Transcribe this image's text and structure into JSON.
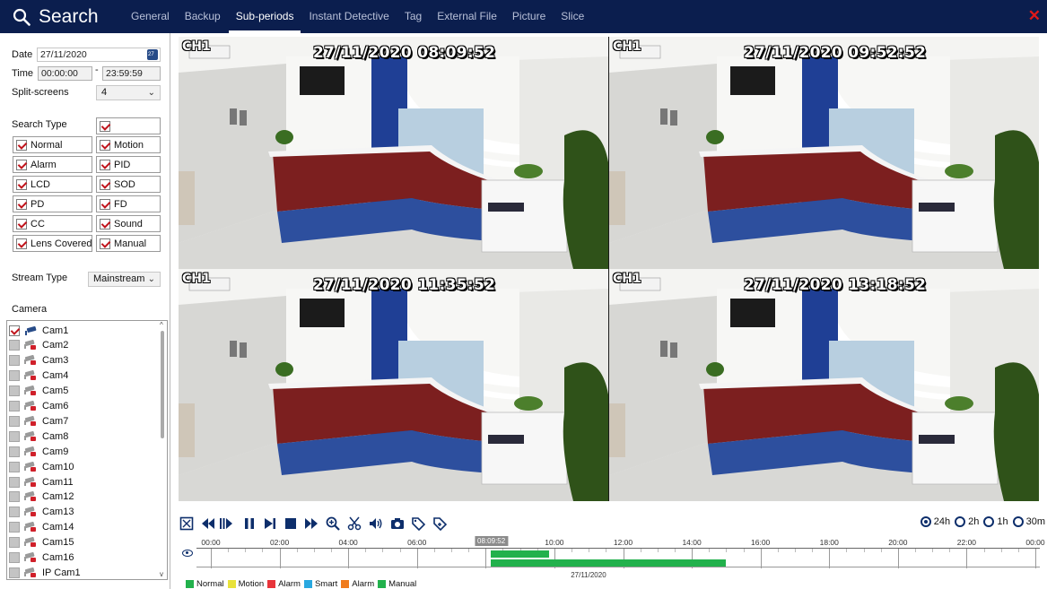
{
  "app": {
    "title": "Search"
  },
  "tabs": [
    "General",
    "Backup",
    "Sub-periods",
    "Instant Detective",
    "Tag",
    "External File",
    "Picture",
    "Slice"
  ],
  "active_tab": "Sub-periods",
  "left": {
    "date_label": "Date",
    "date_value": "27/11/2020",
    "time_label": "Time",
    "time_start": "00:00:00",
    "time_sep": "-",
    "time_end": "23:59:59",
    "split_label": "Split-screens",
    "split_value": "4",
    "search_type_label": "Search Type",
    "search_types": [
      "Normal",
      "Motion",
      "Alarm",
      "PID",
      "LCD",
      "SOD",
      "PD",
      "FD",
      "CC",
      "Sound",
      "Lens Covered",
      "Manual"
    ],
    "stream_label": "Stream Type",
    "stream_value": "Mainstream",
    "camera_label": "Camera",
    "cameras": [
      {
        "name": "Cam1",
        "checked": true
      },
      {
        "name": "Cam2",
        "checked": false
      },
      {
        "name": "Cam3",
        "checked": false
      },
      {
        "name": "Cam4",
        "checked": false
      },
      {
        "name": "Cam5",
        "checked": false
      },
      {
        "name": "Cam6",
        "checked": false
      },
      {
        "name": "Cam7",
        "checked": false
      },
      {
        "name": "Cam8",
        "checked": false
      },
      {
        "name": "Cam9",
        "checked": false
      },
      {
        "name": "Cam10",
        "checked": false
      },
      {
        "name": "Cam11",
        "checked": false
      },
      {
        "name": "Cam12",
        "checked": false
      },
      {
        "name": "Cam13",
        "checked": false
      },
      {
        "name": "Cam14",
        "checked": false
      },
      {
        "name": "Cam15",
        "checked": false
      },
      {
        "name": "Cam16",
        "checked": false
      },
      {
        "name": "IP Cam1",
        "checked": false
      }
    ]
  },
  "video": {
    "cells": [
      {
        "channel": "CH1",
        "timestamp": "27/11/2020 08:09:52",
        "selected": true
      },
      {
        "channel": "CH1",
        "timestamp": "27/11/2020 09:52:52",
        "selected": false
      },
      {
        "channel": "CH1",
        "timestamp": "27/11/2020 11:35:52",
        "selected": false
      },
      {
        "channel": "CH1",
        "timestamp": "27/11/2020 13:18:52",
        "selected": false
      }
    ]
  },
  "controls": [
    "fullscreen-icon",
    "rewind-icon",
    "step-play-icon",
    "pause-icon",
    "next-frame-icon",
    "stop-icon",
    "fast-forward-icon",
    "zoom-icon",
    "clip-icon",
    "volume-icon",
    "snapshot-icon",
    "tag-icon",
    "add-tag-icon"
  ],
  "time_ranges": [
    {
      "label": "24h",
      "selected": true
    },
    {
      "label": "2h",
      "selected": false
    },
    {
      "label": "1h",
      "selected": false
    },
    {
      "label": "30m",
      "selected": false
    }
  ],
  "timeline": {
    "ticks": [
      "00:00",
      "02:00",
      "04:00",
      "06:00",
      "10:00",
      "12:00",
      "14:00",
      "16:00",
      "18:00",
      "20:00",
      "22:00",
      "00:00"
    ],
    "cursor": "08:09:52",
    "date": "27/11/2020",
    "recordings": [
      {
        "lane": 1,
        "start_hour": 8.16,
        "end_hour": 9.85
      },
      {
        "lane": 2,
        "start_hour": 8.16,
        "end_hour": 15.0
      }
    ]
  },
  "legend": [
    {
      "label": "Normal",
      "color": "#22b14c"
    },
    {
      "label": "Motion",
      "color": "#e8e23a"
    },
    {
      "label": "Alarm",
      "color": "#e8343a"
    },
    {
      "label": "Smart",
      "color": "#29a8e0"
    },
    {
      "label": "Alarm",
      "color": "#f07b1d"
    },
    {
      "label": "Manual",
      "color": "#22b14c"
    }
  ]
}
